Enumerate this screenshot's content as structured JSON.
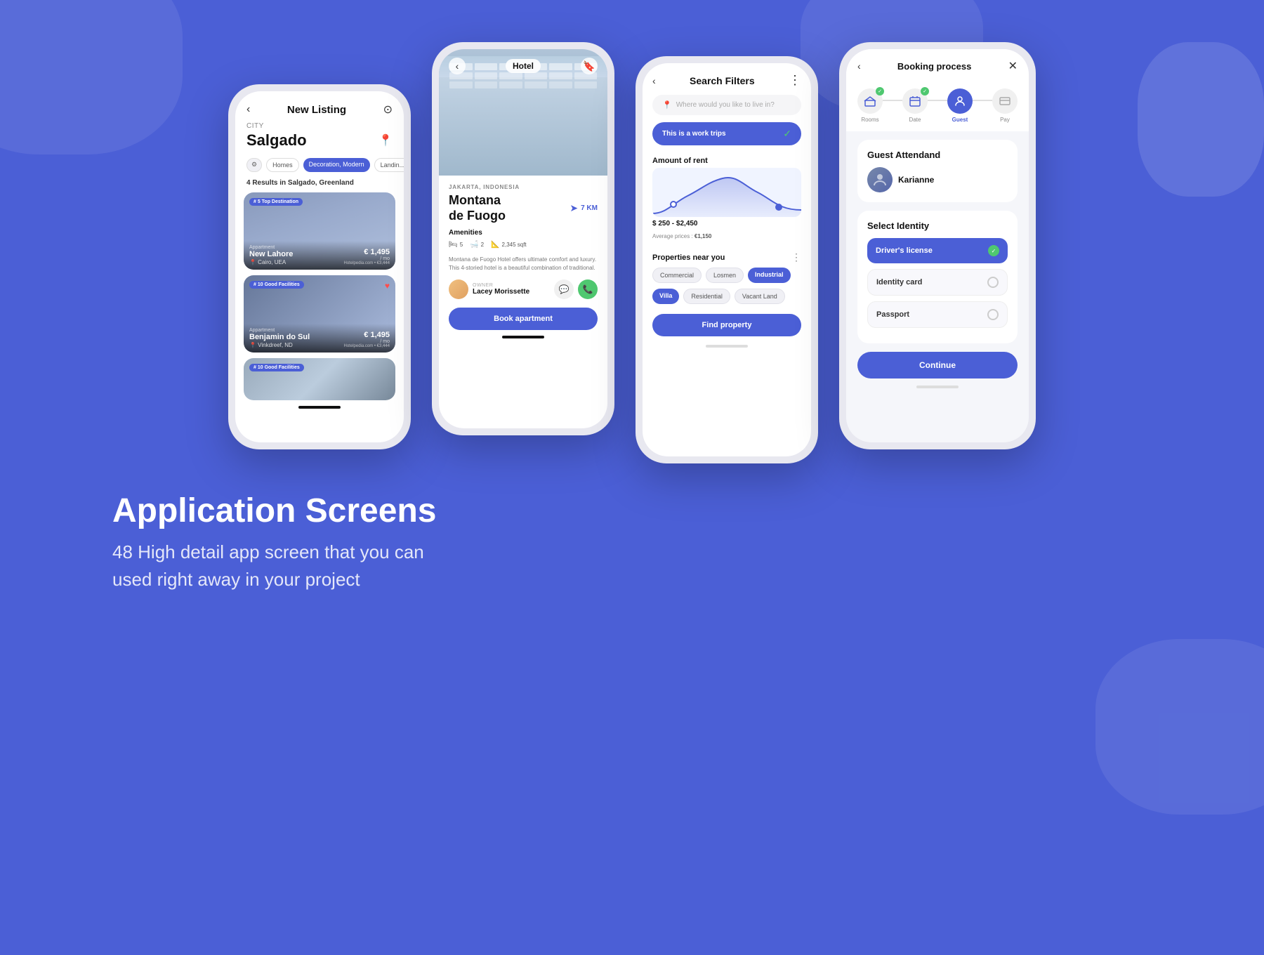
{
  "background": {
    "color": "#4B5FD6"
  },
  "phone1": {
    "header": {
      "title": "New Listing",
      "back": "‹",
      "search": "🔍"
    },
    "city_label": "CITY",
    "city_name": "Salgado",
    "filters": [
      "Homes",
      "Decoration, Modern",
      "Landing"
    ],
    "active_filter": "Decoration, Modern",
    "results_text": "4 Results",
    "results_location": "in Salgado, Greenland",
    "cards": [
      {
        "badge": "# 5 Top Destination",
        "name": "New Lahore",
        "type": "Appartment",
        "location": "Cairo, UEA",
        "price": "€ 1,495",
        "price_sub": "/ mo",
        "price_sub2": "Hotelpedia.com • €3,444"
      },
      {
        "badge": "# 10 Good Facilities",
        "name": "Benjamin do Sul",
        "type": "Appartment",
        "location": "Vinkdreef, ND",
        "price": "€ 1,495",
        "price_sub": "/ mo",
        "price_sub2": "Hotelpedia.com • €3,444",
        "has_heart": true
      },
      {
        "badge": "# 10 Good Facilities",
        "name": "",
        "type": "",
        "location": "",
        "price": "",
        "price_sub": ""
      }
    ]
  },
  "phone2": {
    "header_title": "Hotel",
    "location": "JAKARTA, INDONESIA",
    "name_line1": "Montana",
    "name_line2": "de Fuogo",
    "km": "7 KM",
    "amenities_title": "Amenities",
    "amenities": [
      {
        "icon": "🛏",
        "value": "5"
      },
      {
        "icon": "🛁",
        "value": "2"
      },
      {
        "icon": "📐",
        "value": "2,345 sqft"
      }
    ],
    "description": "Montana de Fuogo Hotel offers ultimate comfort and luxury. This 4-storied hotel is a beautiful combination of traditional.",
    "owner_label": "OWNER",
    "owner_name": "Lacey Morissette",
    "book_btn": "Book apartment"
  },
  "phone3": {
    "title": "Search Filters",
    "search_placeholder": "Where would you like to live in?",
    "active_filter": "This is a work trips",
    "rent_title": "Amount of rent",
    "price_range": "$ 250 - $2,450",
    "avg_price": "Average prices : €1,150",
    "nearby_title": "Properties near you",
    "tags": [
      "Commercial",
      "Losmen",
      "Industrial",
      "Villa",
      "Residential",
      "Vacant Land"
    ],
    "active_tags": [
      "Industrial",
      "Villa"
    ],
    "find_btn": "Find property"
  },
  "phone4": {
    "title": "Booking process",
    "steps": [
      {
        "label": "Rooms",
        "icon": "🏠",
        "active": false,
        "checked": true
      },
      {
        "label": "Date",
        "icon": "📅",
        "active": false,
        "checked": true
      },
      {
        "label": "Guest",
        "icon": "👤",
        "active": true,
        "checked": false
      },
      {
        "label": "Pay",
        "icon": "💳",
        "active": false,
        "checked": false
      }
    ],
    "guest_section": "Guest Attendand",
    "guest_name": "Karianne",
    "identity_section": "Select Identity",
    "identity_options": [
      {
        "label": "Driver's license",
        "selected": true
      },
      {
        "label": "Identity card",
        "selected": false
      },
      {
        "label": "Passport",
        "selected": false
      }
    ],
    "continue_btn": "Continue"
  },
  "bottom": {
    "title": "Application Screens",
    "subtitle_line1": "48 High detail app screen that you can",
    "subtitle_line2": "used right away in your project"
  }
}
